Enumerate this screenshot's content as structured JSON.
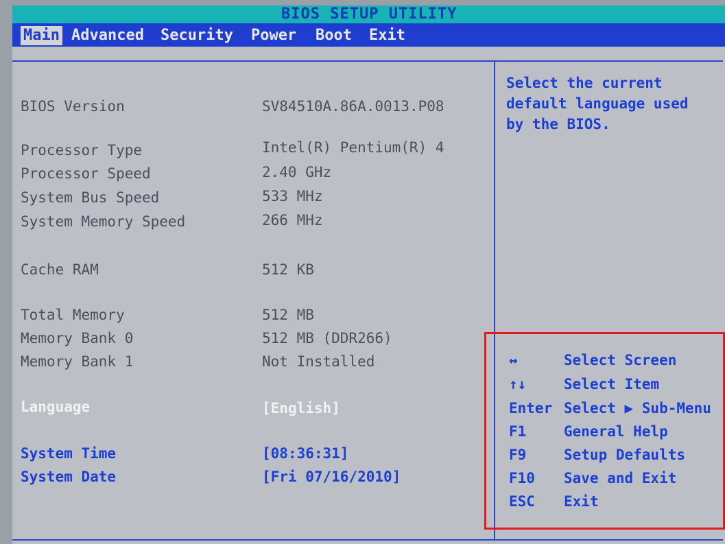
{
  "title": "BIOS SETUP UTILITY",
  "menu": [
    {
      "label": "Main"
    },
    {
      "label": "Advanced"
    },
    {
      "label": "Security"
    },
    {
      "label": "Power"
    },
    {
      "label": "Boot"
    },
    {
      "label": "Exit"
    }
  ],
  "info": {
    "bios_version": {
      "label": "BIOS Version",
      "value": "SV84510A.86A.0013.P08"
    },
    "processor_type": {
      "label": "Processor Type",
      "value": "Intel(R) Pentium(R) 4"
    },
    "processor_speed": {
      "label": "Processor Speed",
      "value": "2.40 GHz"
    },
    "system_bus_speed": {
      "label": "System Bus Speed",
      "value": "533 MHz"
    },
    "system_memory_speed": {
      "label": "System Memory Speed",
      "value": "266 MHz"
    },
    "cache_ram": {
      "label": "Cache RAM",
      "value": "512 KB"
    },
    "total_memory": {
      "label": "Total Memory",
      "value": "512 MB"
    },
    "memory_bank_0": {
      "label": "Memory Bank 0",
      "value": "512 MB (DDR266)"
    },
    "memory_bank_1": {
      "label": "Memory Bank 1",
      "value": "Not Installed"
    }
  },
  "settings": {
    "language": {
      "label": "Language",
      "value": "[English]"
    },
    "system_time": {
      "label": "System Time",
      "value": "[08:36:31]"
    },
    "system_date": {
      "label": "System Date",
      "value": "[Fri 07/16/2010]"
    }
  },
  "help": {
    "lines": [
      "Select the current",
      "default language used",
      "by the BIOS."
    ]
  },
  "keys": [
    {
      "key": "↔",
      "desc": "Select Screen"
    },
    {
      "key": "↑↓",
      "desc": "Select Item"
    },
    {
      "key": "Enter",
      "desc": "Select ▶ Sub-Menu"
    },
    {
      "key": "F1",
      "desc": "General Help"
    },
    {
      "key": "F9",
      "desc": "Setup Defaults"
    },
    {
      "key": "F10",
      "desc": "Save and Exit"
    },
    {
      "key": "ESC",
      "desc": "Exit"
    }
  ],
  "colors": {
    "title_bar": "#17b3b6",
    "menu_bar": "#1f3ed0",
    "panel": "#bcc0c6",
    "accent_blue": "#1c3fd2",
    "highlight": "#e31b1b"
  }
}
